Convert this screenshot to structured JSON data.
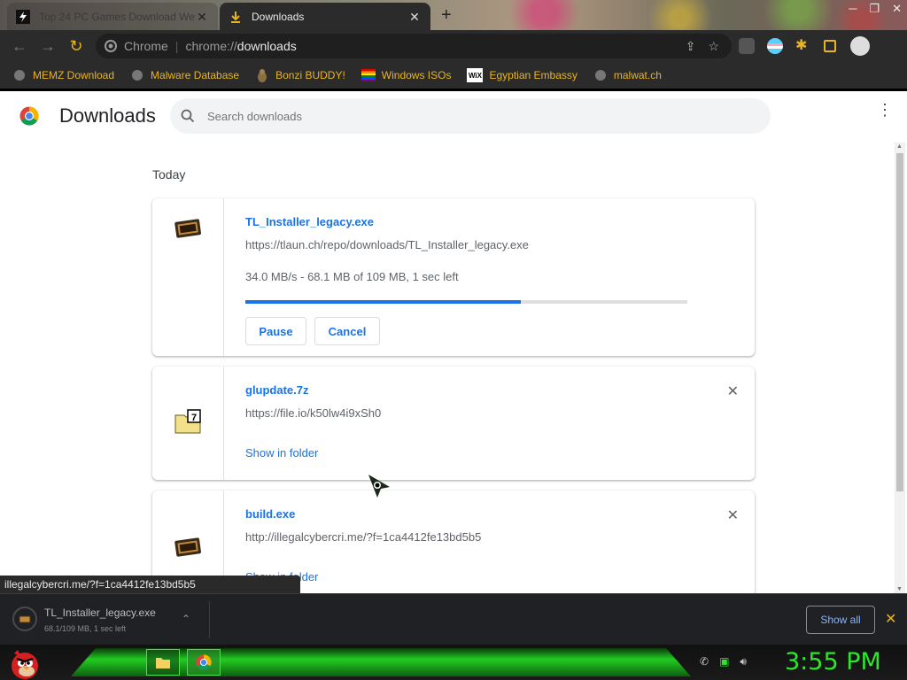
{
  "browser": {
    "tabs": [
      {
        "title": "Top 24 PC Games Download We",
        "active": false
      },
      {
        "title": "Downloads",
        "active": true
      }
    ],
    "omnibox": {
      "scheme": "Chrome",
      "separator": "|",
      "host": "chrome://",
      "path": "downloads"
    },
    "bookmarks": [
      {
        "label": "MEMZ Download",
        "icon": "globe-icon"
      },
      {
        "label": "Malware Database",
        "icon": "globe-icon"
      },
      {
        "label": "Bonzi BUDDY!",
        "icon": "bonzi-icon"
      },
      {
        "label": "Windows ISOs",
        "icon": "windows-icon"
      },
      {
        "label": "Egyptian Embassy",
        "icon": "wix-icon"
      },
      {
        "label": "malwat.ch",
        "icon": "globe-icon"
      }
    ]
  },
  "downloads_page": {
    "title": "Downloads",
    "search_placeholder": "Search downloads",
    "section": "Today",
    "items": [
      {
        "filename": "TL_Installer_legacy.exe",
        "url": "https://tlaun.ch/repo/downloads/TL_Installer_legacy.exe",
        "status": "34.0 MB/s - 68.1 MB of 109 MB, 1 sec left",
        "progress_fraction": 0.624,
        "buttons": [
          "Pause",
          "Cancel"
        ]
      },
      {
        "filename": "glupdate.7z",
        "url": "https://file.io/k50lw4i9xSh0",
        "link": "Show in folder"
      },
      {
        "filename": "build.exe",
        "url": "http://illegalcybercri.me/?f=1ca4412fe13bd5b5",
        "link": "Show in folder"
      }
    ]
  },
  "status_bubble": "illegalcybercri.me/?f=1ca4412fe13bd5b5",
  "shelf": {
    "filename": "TL_Installer_legacy.exe",
    "status": "68.1/109 MB, 1 sec left",
    "show_all": "Show all"
  },
  "taskbar": {
    "clock": "3:55 PM"
  },
  "colors": {
    "link_blue": "#1a73e8",
    "bookmark_text": "#e8b422",
    "clock_green": "#2ee62e"
  }
}
